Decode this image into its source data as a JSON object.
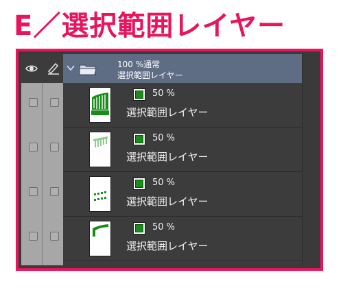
{
  "heading": "E／選択範囲レイヤー",
  "folder": {
    "line1": "100 %通常",
    "line2": "選択範囲レイヤー"
  },
  "layers": [
    {
      "opacity": "50 %",
      "name": "選択範囲レイヤー"
    },
    {
      "opacity": "50 %",
      "name": "選択範囲レイヤー"
    },
    {
      "opacity": "50 %",
      "name": "選択範囲レイヤー"
    },
    {
      "opacity": "50 %",
      "name": "選択範囲レイヤー"
    }
  ],
  "colors": {
    "accent": "#e8155e",
    "folder_row": "#5e6c84",
    "mask_green": "#1a8c1a"
  },
  "icons": [
    "eye-icon",
    "pen-icon",
    "chevron-down-icon",
    "folder-icon",
    "layer-mask-icon"
  ]
}
